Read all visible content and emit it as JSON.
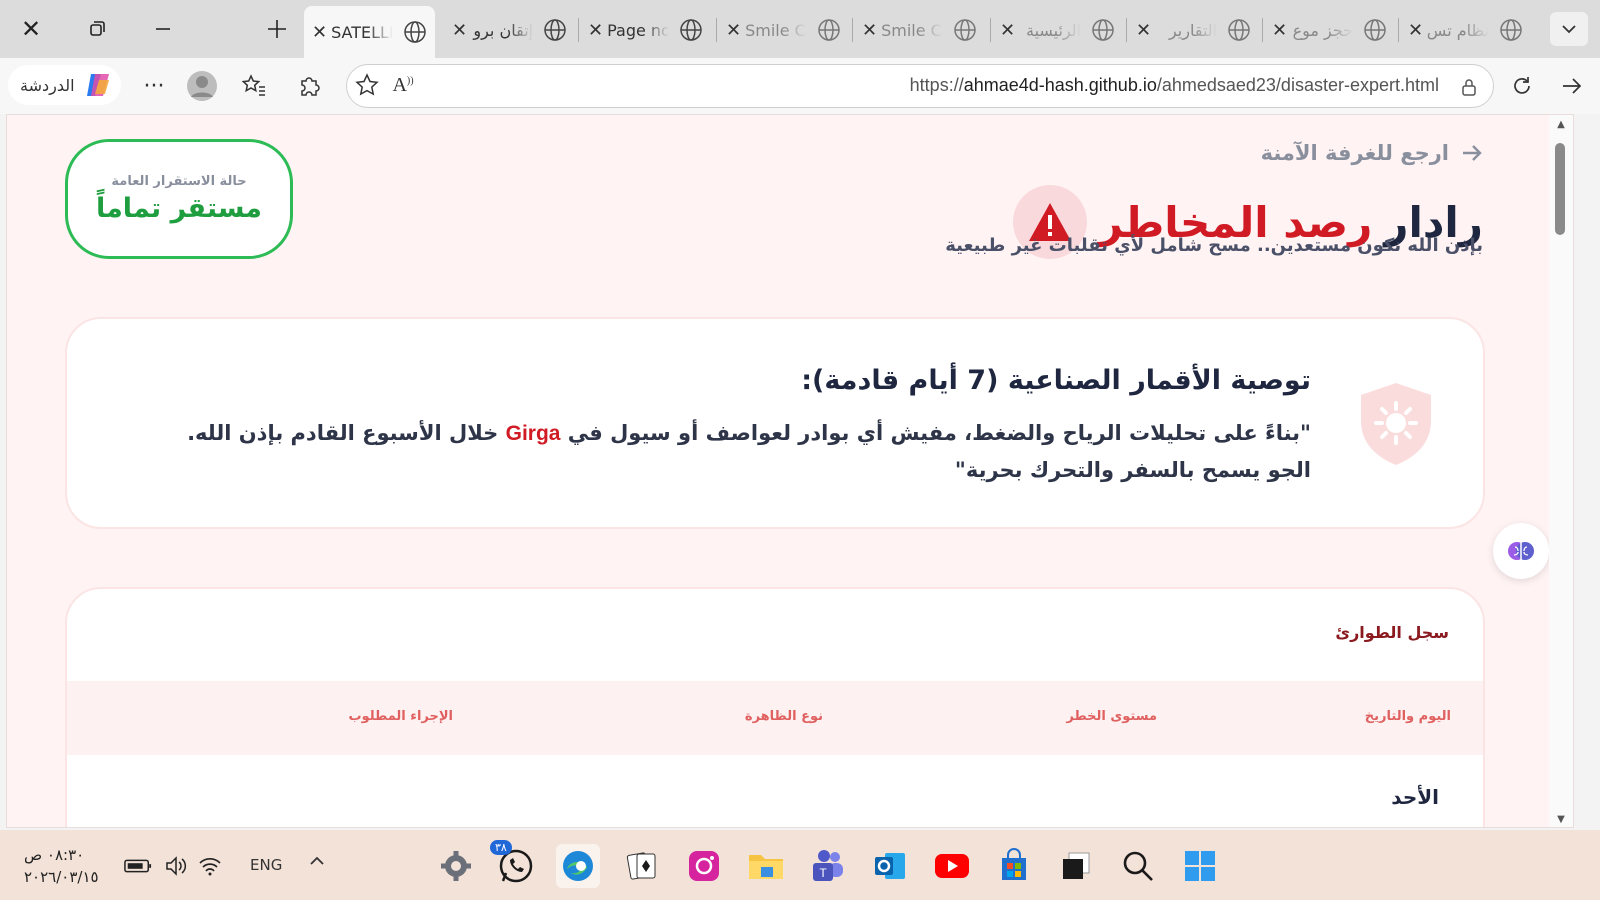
{
  "browser": {
    "tabs": [
      {
        "label": "SATELLI",
        "active": true
      },
      {
        "label": "إتقان برو"
      },
      {
        "label": "Page no"
      },
      {
        "label": "Smile C"
      },
      {
        "label": "Smile C"
      },
      {
        "label": "الرئيسية"
      },
      {
        "label": "التقارير"
      },
      {
        "label": "حجز موع"
      },
      {
        "label": "نظام تس"
      }
    ],
    "copilot_label": "الدردشة",
    "url_prefix": "https://",
    "url_host": "ahmae4d-hash.github.io",
    "url_path": "/ahmedsaed23/disaster-expert.html"
  },
  "page": {
    "back_link": "ارجع للغرفة الآمنة",
    "title_plain": "رادار",
    "title_red": "رصد المخاطر",
    "subtitle": "بإذن الله نكون مستعدين.. مسح شامل لأي تقلبات غير طبيعية",
    "stability": {
      "label": "حالة الاستقرار العامة",
      "value": "مستقر تماماً"
    },
    "recommendation": {
      "title": "توصية الأقمار الصناعية (7 أيام قادمة):",
      "text_before": "\"بناءً على تحليلات الرياح والضغط، مفيش أي بوادر لعواصف أو سيول في",
      "city": "Girga",
      "text_after": "خلال الأسبوع القادم بإذن الله. الجو يسمح بالسفر والتحرك بحرية\""
    },
    "log": {
      "title": "سجل الطوارئ",
      "headers": [
        "اليوم والتاريخ",
        "مستوى الخطر",
        "نوع الظاهرة",
        "الإجراء المطلوب"
      ],
      "first_row_day": "الأحد"
    }
  },
  "taskbar": {
    "time": "٠٨:٣٠ ص",
    "date": "٢٠٢٦/٠٣/١٥",
    "lang": "ENG",
    "whatsapp_badge": "٣٨"
  },
  "colors": {
    "accent_red": "#d11b24",
    "stable_green": "#1f9e3f",
    "page_bg": "#fff3f3"
  }
}
